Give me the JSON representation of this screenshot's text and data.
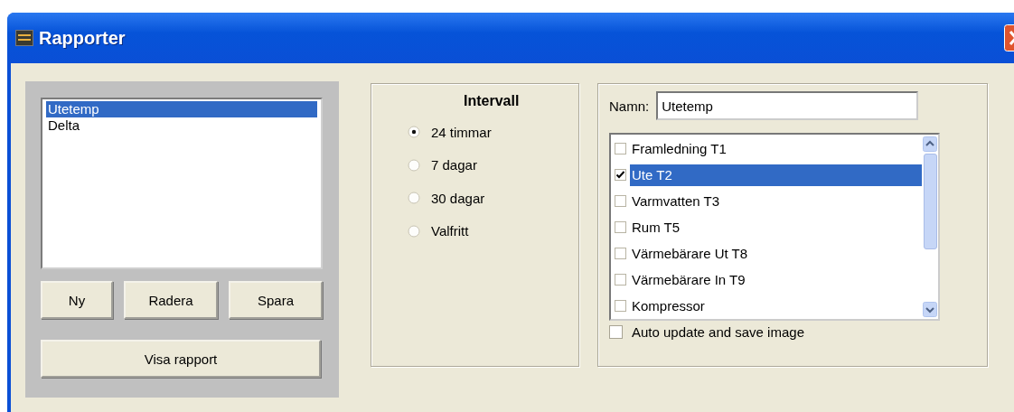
{
  "window": {
    "title": "Rapporter"
  },
  "reports": {
    "items": [
      {
        "label": "Utetemp",
        "selected": true
      },
      {
        "label": "Delta",
        "selected": false
      }
    ],
    "buttons": [
      "Ny",
      "Radera",
      "Spara"
    ],
    "show_button": "Visa rapport"
  },
  "interval": {
    "title": "Intervall",
    "options": [
      {
        "label": "24 timmar",
        "selected": true
      },
      {
        "label": "7 dagar",
        "selected": false
      },
      {
        "label": "30 dagar",
        "selected": false
      },
      {
        "label": "Valfritt",
        "selected": false
      }
    ]
  },
  "name": {
    "label": "Namn:",
    "value": "Utetemp"
  },
  "sensors": [
    {
      "label": "Framledning T1",
      "checked": false,
      "selected": false
    },
    {
      "label": "Ute T2",
      "checked": true,
      "selected": true
    },
    {
      "label": "Varmvatten T3",
      "checked": false,
      "selected": false
    },
    {
      "label": "Rum T5",
      "checked": false,
      "selected": false
    },
    {
      "label": "Värmebärare Ut T8",
      "checked": false,
      "selected": false
    },
    {
      "label": "Värmebärare In T9",
      "checked": false,
      "selected": false
    },
    {
      "label": "Kompressor",
      "checked": false,
      "selected": false
    }
  ],
  "auto_update": {
    "label": "Auto update and save image",
    "checked": false
  }
}
